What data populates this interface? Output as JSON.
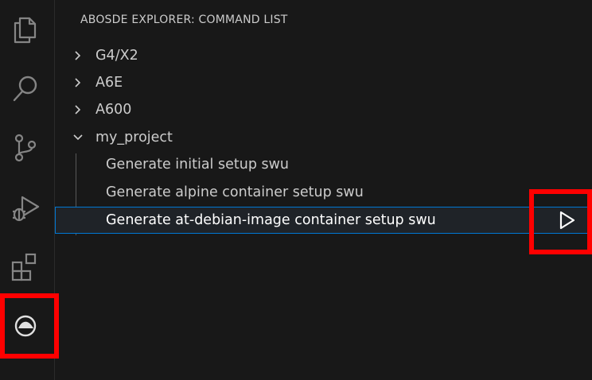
{
  "activity_bar": {
    "icons": [
      "files-icon",
      "search-icon",
      "source-control-icon",
      "run-debug-icon",
      "extensions-icon",
      "abosde-icon"
    ]
  },
  "sidebar": {
    "title": "ABOSDE EXPLORER: COMMAND LIST",
    "tree": [
      {
        "label": "G4/X2",
        "expanded": false
      },
      {
        "label": "A6E",
        "expanded": false
      },
      {
        "label": "A600",
        "expanded": false
      },
      {
        "label": "my_project",
        "expanded": true,
        "children": [
          {
            "label": "Generate initial setup swu"
          },
          {
            "label": "Generate alpine container setup swu"
          },
          {
            "label": "Generate at-debian-image container setup swu",
            "selected": true
          }
        ]
      }
    ]
  },
  "colors": {
    "background": "#181818",
    "selection_border": "#0078d4",
    "highlight": "#ff0000",
    "text": "#cccccc"
  }
}
